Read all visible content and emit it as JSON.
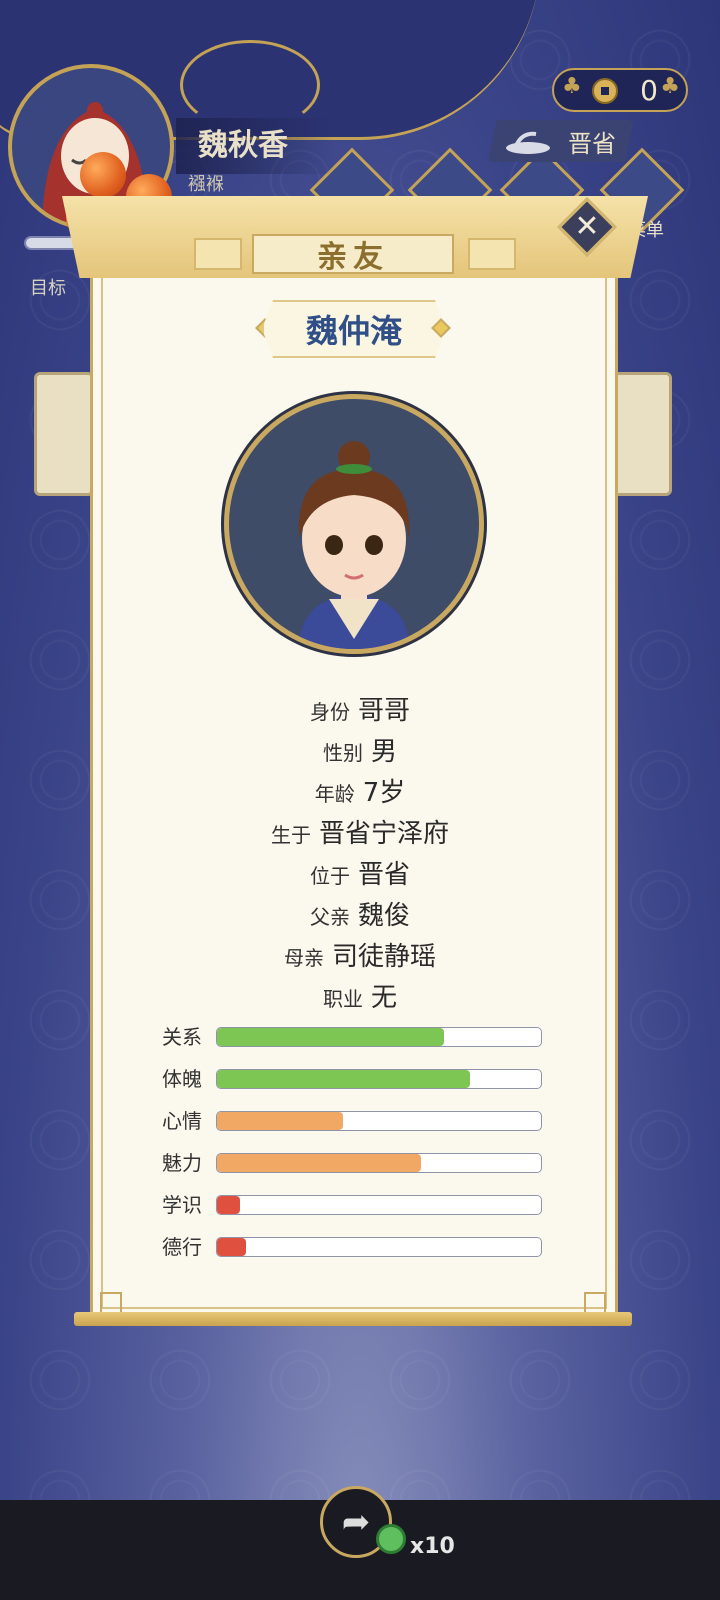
{
  "top_bar": {
    "player_name": "魏秋香",
    "player_sub": "襁褓",
    "goal_label": "目标",
    "coins": "0",
    "province": "晋省",
    "menu_label": "菜单"
  },
  "panel": {
    "title": "亲友",
    "person_name": "魏仲淹",
    "info": [
      {
        "key": "身份",
        "value": "哥哥"
      },
      {
        "key": "性别",
        "value": "男"
      },
      {
        "key": "年龄",
        "value": "7岁"
      },
      {
        "key": "生于",
        "value": "晋省宁泽府"
      },
      {
        "key": "位于",
        "value": "晋省"
      },
      {
        "key": "父亲",
        "value": "魏俊"
      },
      {
        "key": "母亲",
        "value": "司徒静瑶"
      },
      {
        "key": "职业",
        "value": "无"
      }
    ],
    "stats": [
      {
        "label": "关系",
        "value": 0.7,
        "color": "#7ec653"
      },
      {
        "label": "体魄",
        "value": 0.78,
        "color": "#7ec653"
      },
      {
        "label": "心情",
        "value": 0.39,
        "color": "#f2a865"
      },
      {
        "label": "魅力",
        "value": 0.63,
        "color": "#f2a865"
      },
      {
        "label": "学识",
        "value": 0.07,
        "color": "#e0503e"
      },
      {
        "label": "德行",
        "value": 0.09,
        "color": "#e0503e"
      }
    ]
  },
  "bottom": {
    "share_icon": "share-icon",
    "reward_count": "x10"
  }
}
